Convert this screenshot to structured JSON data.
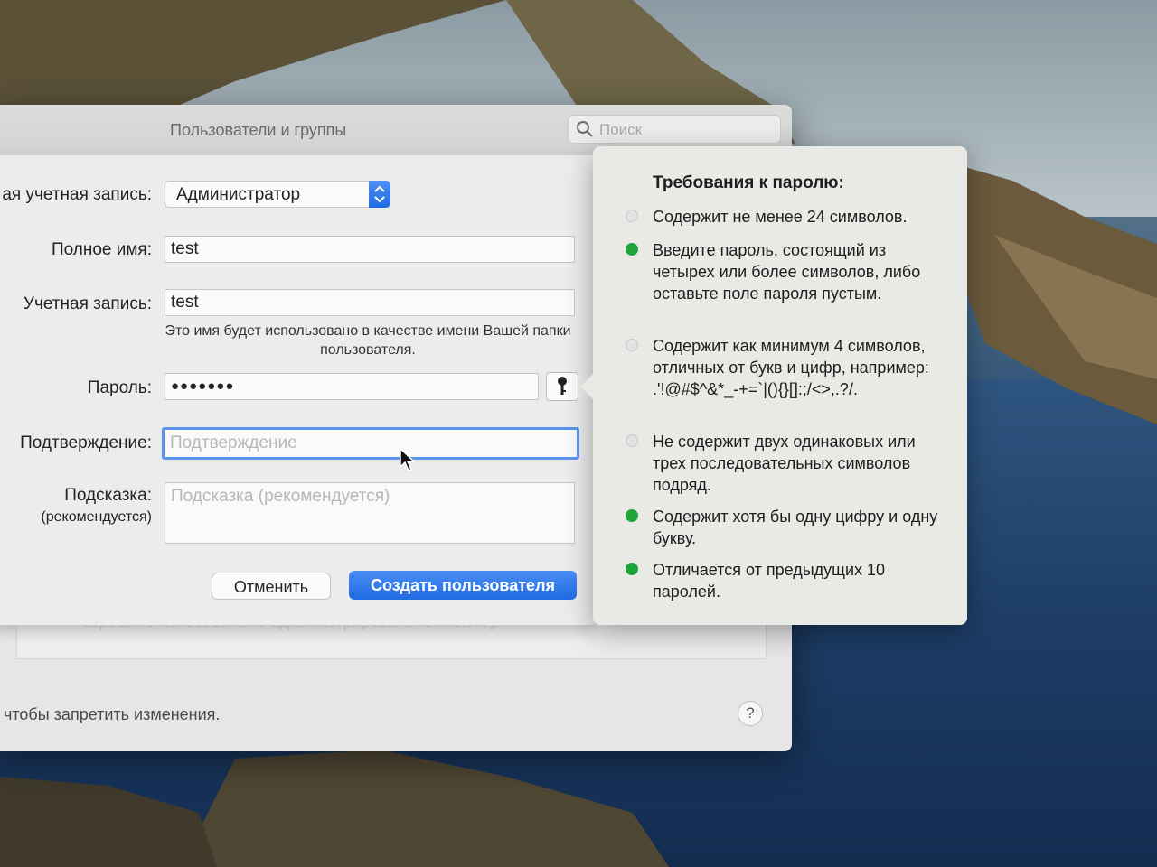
{
  "window": {
    "title": "Пользователи и группы",
    "search_placeholder": "Поиск",
    "background_row_text": "Разрешить пользователю администрировать компьютер",
    "footer_text": "чтобы запретить изменения.",
    "help_label": "?"
  },
  "form": {
    "account_type_label": "ая учетная запись:",
    "account_type_value": "Администратор",
    "full_name_label": "Полное имя:",
    "full_name_value": "test",
    "account_name_label": "Учетная запись:",
    "account_name_value": "test",
    "account_name_hint": "Это имя будет использовано в качестве имени Вашей папки пользователя.",
    "password_label": "Пароль:",
    "password_value": "●●●●●●●",
    "confirm_label": "Подтверждение:",
    "confirm_placeholder": "Подтверждение",
    "hint_label": "Подсказка:",
    "hint_label_sub": "(рекомендуется)",
    "hint_placeholder": "Подсказка (рекомендуется)",
    "cancel_button": "Отменить",
    "create_button": "Создать пользователя"
  },
  "requirements": {
    "title": "Требования к паролю:",
    "items": [
      {
        "text": "Содержит не менее 24 символов.",
        "met": false
      },
      {
        "text": "Введите пароль, состоящий из четырех или более символов, либо оставьте поле пароля пустым.",
        "met": true
      },
      {
        "text": "Содержит как минимум 4 символов, отличных от букв и цифр, например: .'!@#$^&*_-+=`|(){}[]:;/<>,.?/.",
        "met": false
      },
      {
        "text": "Не содержит двух одинаковых или трех последовательных символов подряд.",
        "met": false
      },
      {
        "text": "Содержит хотя бы одну цифру и одну букву.",
        "met": true
      },
      {
        "text": "Отличается от предыдущих 10 паролей.",
        "met": true
      }
    ]
  },
  "colors": {
    "met": "#1ea63b",
    "unmet": "#e2e2e2",
    "accent": "#1f6be3"
  }
}
